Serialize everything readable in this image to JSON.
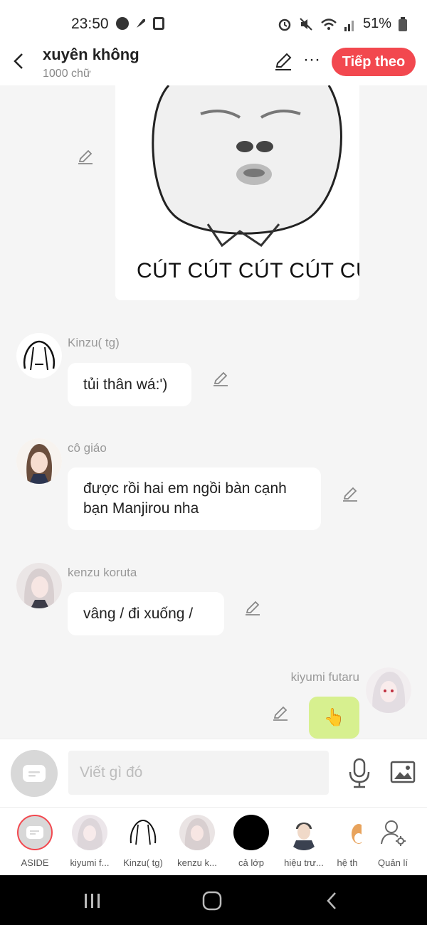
{
  "status": {
    "time": "23:50",
    "battery": "51%"
  },
  "header": {
    "title": "xuyên không",
    "subtitle": "1000 chữ",
    "next_label": "Tiếp theo"
  },
  "meme": {
    "caption": "CÚT CÚT CÚT CÚT CÚ"
  },
  "messages": [
    {
      "sender": "Kinzu( tg)",
      "text": "tủi thân wá:')"
    },
    {
      "sender": "cô giáo",
      "text": "được rồi hai em ngồi bàn cạnh bạn Manjirou nha"
    },
    {
      "sender": "kenzu koruta",
      "text": "vâng / đi xuống /"
    },
    {
      "sender": "kiyumi futaru",
      "text": ""
    }
  ],
  "input": {
    "placeholder": "Viết gì đó"
  },
  "characters": [
    {
      "label": "ASIDE"
    },
    {
      "label": "kiyumi f..."
    },
    {
      "label": "Kinzu( tg)"
    },
    {
      "label": "kenzu k..."
    },
    {
      "label": "cả lớp"
    },
    {
      "label": "hiệu trư..."
    },
    {
      "label": "hệ th"
    },
    {
      "label": "Quản lí"
    }
  ],
  "colors": {
    "accent": "#f2484f",
    "own_bubble": "#d7f08f",
    "background": "#f5f5f5"
  }
}
